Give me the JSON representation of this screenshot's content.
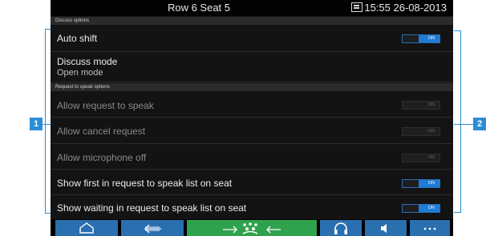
{
  "status_bar": {
    "seat": "Row 6 Seat 5",
    "datetime": "15:55 26-08-2013",
    "dock_icon": "console-icon"
  },
  "sections": {
    "discuss": "Discuss options",
    "request": "Request to speak options"
  },
  "settings": {
    "auto_shift": {
      "label": "Auto shift",
      "state": "ON"
    },
    "discuss_mode": {
      "label": "Discuss mode",
      "value": "Open mode"
    },
    "allow_request": {
      "label": "Allow request to speak",
      "state": "ON"
    },
    "allow_cancel": {
      "label": "Allow cancel request",
      "state": "ON"
    },
    "allow_mic_off": {
      "label": "Allow microphone off",
      "state": "ON"
    },
    "show_first": {
      "label": "Show first in request to speak list on seat",
      "state": "ON"
    },
    "show_waiting": {
      "label": "Show waiting in request to speak list on seat",
      "state": "ON"
    }
  },
  "toolbar": {
    "icons": [
      "home-icon",
      "back-icon",
      "meeting-icon",
      "headphones-icon",
      "speaker-icon",
      "more-icon"
    ],
    "colors": {
      "blue": "#2a6fb0",
      "green": "#2fa24e"
    }
  },
  "callouts": {
    "left": "1",
    "right": "2"
  }
}
